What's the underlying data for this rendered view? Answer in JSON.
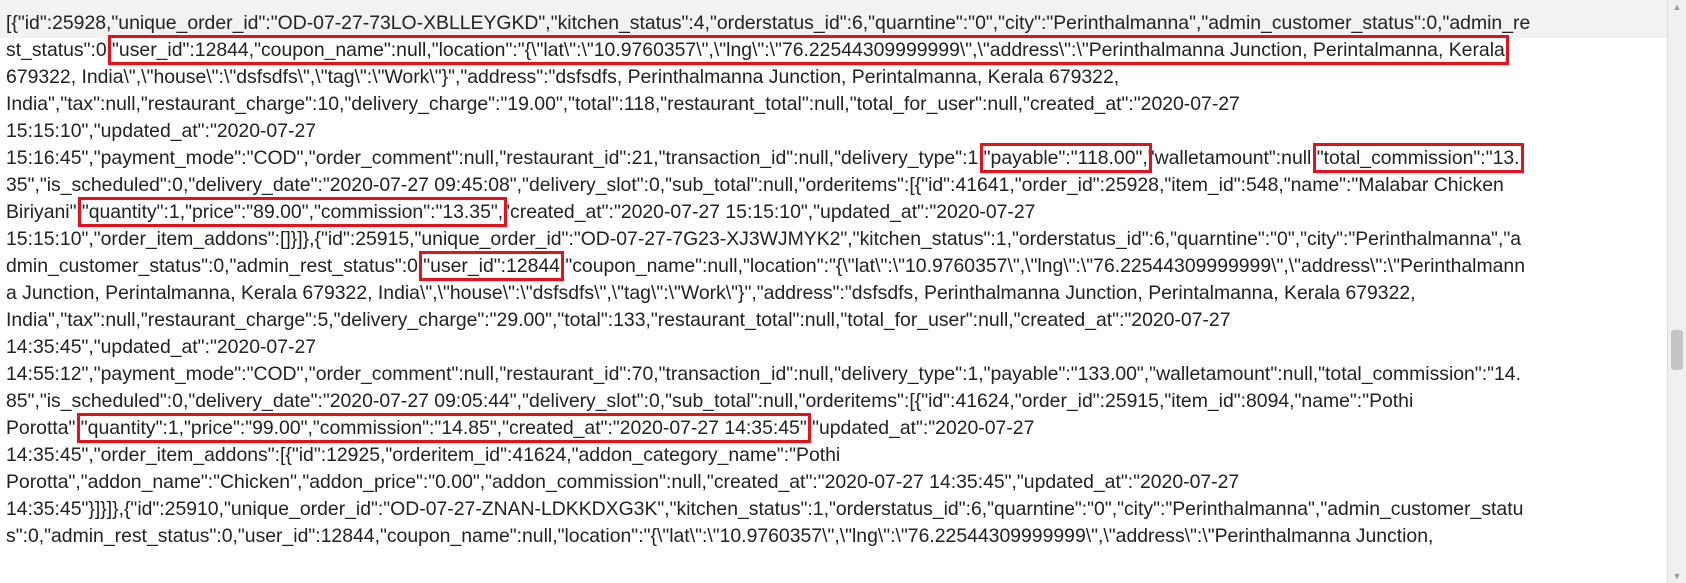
{
  "raw_json_lines": [
    "[{\"id\":25928,\"unique_order_id\":\"OD-07-27-73LO-XBLLEYGKD\",\"kitchen_status\":4,\"orderstatus_id\":6,\"quarntine\":\"0\",\"city\":\"Perinthalmanna\",\"admin_customer_status\":0,\"admin_re",
    "st_status\":0,",
    "\"user_id\":12844,\"coupon_name\":null,\"location\":\"{\\\"lat\\\":\\\"10.9760357\\\",\\\"lng\\\":\\\"76.22544309999999\\\",\\\"address\\\":\\\"Perinthalmanna Junction, Perintalmanna, Kerala",
    "679322, India\\\",\\\"house\\\":\\\"dsfsdfs\\\",\\\"tag\\\":\\\"Work\\\"}\",\"address\":\"dsfsdfs, Perinthalmanna Junction, Perintalmanna, Kerala 679322,",
    "India\",\"tax\":null,\"restaurant_charge\":10,\"delivery_charge\":\"19.00\",\"total\":118,\"restaurant_total\":null,\"total_for_user\":null,\"created_at\":\"2020-07-27",
    "15:15:10\",\"updated_at\":\"2020-07-27",
    "15:16:45\",\"payment_mode\":\"COD\",\"order_comment\":null,\"restaurant_id\":21,\"transaction_id\":null,\"delivery_type\":1,",
    "\"payable\":\"118.00\",",
    "\"walletamount\":null,",
    "\"total_commission\":\"13.",
    "35\",\"is_scheduled\":0,\"delivery_date\":\"2020-07-27 09:45:08\",\"delivery_slot\":0,\"sub_total\":null,\"orderitems\":[{\"id\":41641,\"order_id\":25928,\"item_id\":548,\"name\":\"Malabar Chicken",
    "Biriyani\",",
    "\"quantity\":1,\"price\":\"89.00\",\"commission\":\"13.35\",",
    "\"created_at\":\"2020-07-27 15:15:10\",\"updated_at\":\"2020-07-27",
    "15:15:10\",\"order_item_addons\":[]}]},{\"id\":25915,\"unique_order_id\":\"OD-07-27-7G23-XJ3WJMYK2\",\"kitchen_status\":1,\"orderstatus_id\":6,\"quarntine\":\"0\",\"city\":\"Perinthalmanna\",\"a",
    "dmin_customer_status\":0,\"admin_rest_status\":0,",
    "\"user_id\":12844",
    ",\"coupon_name\":null,\"location\":\"{\\\"lat\\\":\\\"10.9760357\\\",\\\"lng\\\":\\\"76.22544309999999\\\",\\\"address\\\":\\\"Perinthalmann",
    "a Junction, Perintalmanna, Kerala 679322, India\\\",\\\"house\\\":\\\"dsfsdfs\\\",\\\"tag\\\":\\\"Work\\\"}\",\"address\":\"dsfsdfs, Perinthalmanna Junction, Perintalmanna, Kerala 679322,",
    "India\",\"tax\":null,\"restaurant_charge\":5,\"delivery_charge\":\"29.00\",\"total\":133,\"restaurant_total\":null,\"total_for_user\":null,\"created_at\":\"2020-07-27",
    "14:35:45\",\"updated_at\":\"2020-07-27",
    "14:55:12\",\"payment_mode\":\"COD\",\"order_comment\":null,\"restaurant_id\":70,\"transaction_id\":null,\"delivery_type\":1,\"payable\":\"133.00\",\"walletamount\":null,\"total_commission\":\"14.",
    "85\",\"is_scheduled\":0,\"delivery_date\":\"2020-07-27 09:05:44\",\"delivery_slot\":0,\"sub_total\":null,\"orderitems\":[{\"id\":41624,\"order_id\":25915,\"item_id\":8094,\"name\":\"Pothi",
    "Porotta\",",
    "\"quantity\":1,\"price\":\"99.00\",\"commission\":\"14.85\",\"created_at\":\"2020-07-27 14:35:45\"",
    ",\"updated_at\":\"2020-07-27",
    "14:35:45\",\"order_item_addons\":[{\"id\":12925,\"orderitem_id\":41624,\"addon_category_name\":\"Pothi",
    "Porotta\",\"addon_name\":\"Chicken\",\"addon_price\":\"0.00\",\"addon_commission\":null,\"created_at\":\"2020-07-27 14:35:45\",\"updated_at\":\"2020-07-27",
    "14:35:45\"}]}]},{\"id\":25910,\"unique_order_id\":\"OD-07-27-ZNAN-LDKKDXG3K\",\"kitchen_status\":1,\"orderstatus_id\":6,\"quarntine\":\"0\",\"city\":\"Perinthalmanna\",\"admin_customer_statu",
    "s\":0,\"admin_rest_status\":0,\"user_id\":12844,\"coupon_name\":null,\"location\":\"{\\\"lat\\\":\\\"10.9760357\\\",\\\"lng\\\":\\\"76.22544309999999\\\",\\\"address\\\":\\\"Perinthalmanna Junction,"
  ],
  "colors": {
    "highlight_box": "#e8101a",
    "text": "#222222"
  }
}
